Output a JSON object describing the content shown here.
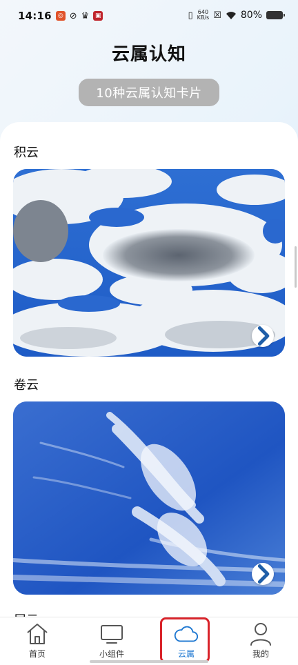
{
  "status_bar": {
    "time": "14:16",
    "net_speed_value": "640",
    "net_speed_unit": "KB/s",
    "battery_percent": "80%"
  },
  "header": {
    "title": "云属认知",
    "subtitle_button": "10种云属认知卡片"
  },
  "sections": [
    {
      "title": "积云"
    },
    {
      "title": "卷云"
    },
    {
      "title": "层云"
    }
  ],
  "bottom_nav": {
    "items": [
      {
        "label": "首页",
        "icon": "home-icon"
      },
      {
        "label": "小组件",
        "icon": "monitor-icon"
      },
      {
        "label": "云属",
        "icon": "cloud-icon",
        "active": true
      },
      {
        "label": "我的",
        "icon": "user-icon"
      }
    ]
  },
  "colors": {
    "accent": "#1f78d1",
    "highlight": "#d9232a",
    "pill_bg": "#b3b3b3",
    "sky_blue": "#2b63c9"
  }
}
